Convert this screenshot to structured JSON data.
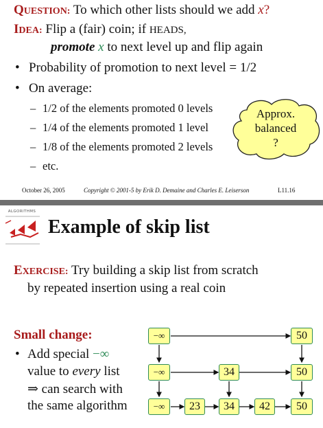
{
  "slide1": {
    "question": {
      "label_first": "Q",
      "label_rest": "UESTION:",
      "text": "To which other lists should we add",
      "var": "x",
      "end": "?"
    },
    "idea": {
      "label_first": "I",
      "label_rest": "DEA:",
      "text_a": "Flip a (fair) coin; if",
      "heads": "HEADS,",
      "promote": "promote",
      "var": "x",
      "text_b": "to next level up and flip again"
    },
    "bullets": [
      "Probability of promotion to next level = 1/2",
      "On average:"
    ],
    "subitems": [
      "1/2 of the elements promoted 0 levels",
      "1/4 of the elements promoted 1 level",
      "1/8 of the elements promoted 2 levels",
      "etc."
    ],
    "cloud": {
      "line1": "Approx.",
      "line2": "balanced",
      "line3": "?"
    },
    "footer": {
      "date": "October 26, 2005",
      "copyright": "Copyright © 2001-5 by Erik D. Demaine and Charles E. Leiserson",
      "page": "L11.16"
    }
  },
  "slide2": {
    "logo_text": "ALGORITHMS",
    "title": "Example of skip list",
    "exercise": {
      "label_first": "E",
      "label_rest": "XERCISE:",
      "text1": "Try building a skip list from scratch",
      "text2": "by repeated insertion using a real coin"
    },
    "small_change": "Small change:",
    "bullet": {
      "line1_a": "Add special",
      "line1_val": "−∞",
      "line2_a": "value to",
      "line2_em": "every",
      "line2_b": "list",
      "line3": "⇒ can search with",
      "line4": "the same algorithm"
    },
    "skiplist": {
      "top": [
        "−∞",
        "50"
      ],
      "middle": [
        "−∞",
        "34",
        "50"
      ],
      "bottom": [
        "−∞",
        "23",
        "34",
        "42",
        "50"
      ]
    }
  }
}
